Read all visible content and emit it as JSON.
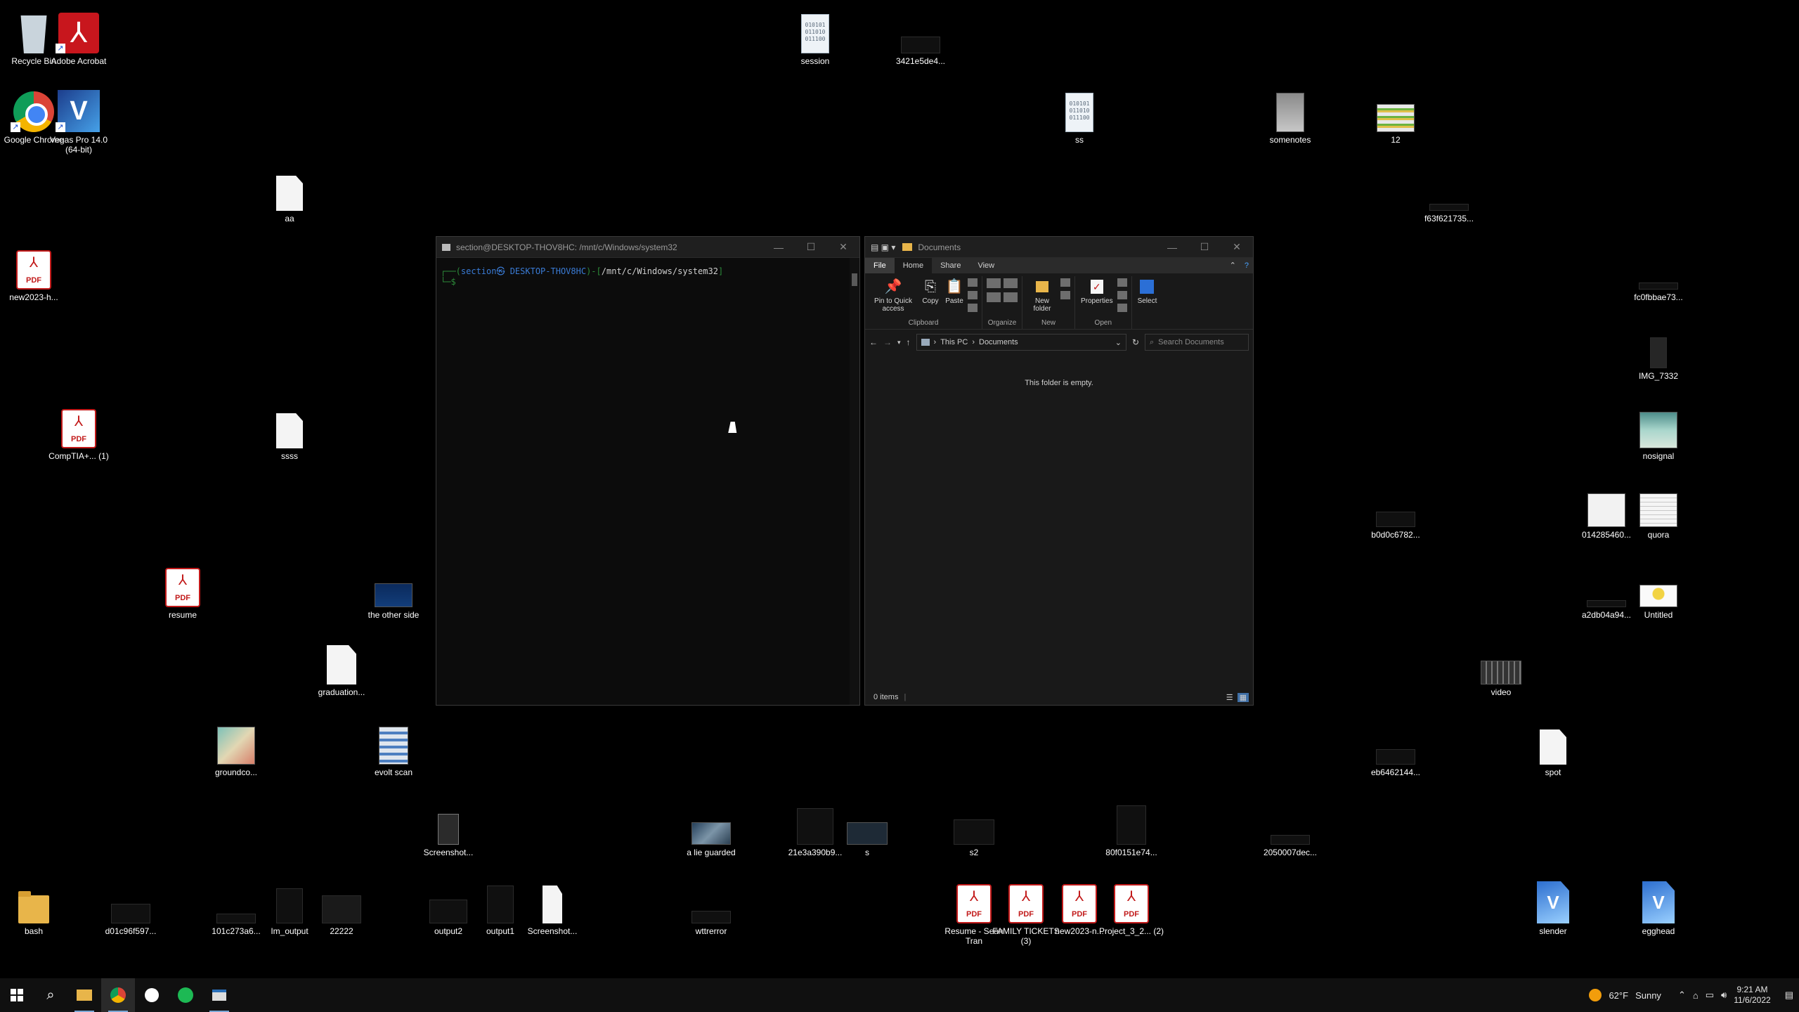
{
  "desktop": {
    "recycle_bin": "Recycle Bin",
    "adobe_acrobat": "Adobe Acrobat",
    "google_chrome": "Google Chrome",
    "vegas_pro": "Vegas Pro 14.0 (64-bit)",
    "aa": "aa",
    "new2023_h": "new2023-h...",
    "comptia": "CompTIA+... (1)",
    "ssss": "ssss",
    "resume": "resume",
    "the_other_side": "the other side",
    "graduation": "graduation...",
    "groundco": "groundco...",
    "evolt_scan": "evolt scan",
    "screenshot_1": "Screenshot...",
    "bash": "bash",
    "d01c96f597": "d01c96f597...",
    "101c273a6": "101c273a6...",
    "im_output": "Im_output",
    "n22222": "22222",
    "output2": "output2",
    "output1": "output1",
    "screenshot_2": "Screenshot...",
    "a_lie_guarded": "a lie guarded",
    "wttrerror": "wttrerror",
    "n21e3a390b9": "21e3a390b9...",
    "s": "s",
    "s2": "s2",
    "resume_sean": "Resume - Sean Tran",
    "family_tickets": "FAMILY TICKETS (3)",
    "new2023_n": "new2023-n...",
    "project_3": "Project_3_2... (2)",
    "n80f0151e74": "80f0151e74...",
    "n2050007dec": "2050007dec...",
    "session": "session",
    "n3421e5de4": "3421e5de4...",
    "ss": "ss",
    "somenotes": "somenotes",
    "n12": "12",
    "f63f621735": "f63f621735...",
    "fc0fbbae73": "fc0fbbae73...",
    "img_7332": "IMG_7332",
    "nosignal": "nosignal",
    "b0d0c6782": "b0d0c6782...",
    "n014285460": "014285460...",
    "quora": "quora",
    "a2db04a94": "a2db04a94...",
    "untitled": "Untitled",
    "video": "video",
    "eb6462144": "eb6462144...",
    "spot": "spot",
    "slender": "slender",
    "egghead": "egghead"
  },
  "terminal": {
    "title": "section@DESKTOP-THOV8HC: /mnt/c/Windows/system32",
    "prompt_open": "┌──(",
    "user_host": "section㉿ DESKTOP-THOV8HC",
    "prompt_mid": ")-[",
    "cwd": "/mnt/c/Windows/system32",
    "prompt_close": "]",
    "prompt_second": "└─$"
  },
  "explorer": {
    "title": "Documents",
    "tabs": [
      "File",
      "Home",
      "Share",
      "View"
    ],
    "ribbon": {
      "pin": "Pin to Quick access",
      "copy": "Copy",
      "paste": "Paste",
      "clipboard": "Clipboard",
      "organize": "Organize",
      "new_folder": "New folder",
      "new": "New",
      "properties": "Properties",
      "open": "Open",
      "select": "Select"
    },
    "breadcrumb": [
      "This PC",
      "Documents"
    ],
    "search_placeholder": "Search Documents",
    "empty_message": "This folder is empty.",
    "status": "0 items"
  },
  "taskbar": {
    "weather_temp": "62°F",
    "weather_desc": "Sunny",
    "time": "9:21 AM",
    "date": "11/6/2022"
  },
  "colors": {
    "terminal_prompt": "#2d8c3a",
    "terminal_user": "#3a7bd5",
    "pdf_red": "#c21a1a"
  }
}
